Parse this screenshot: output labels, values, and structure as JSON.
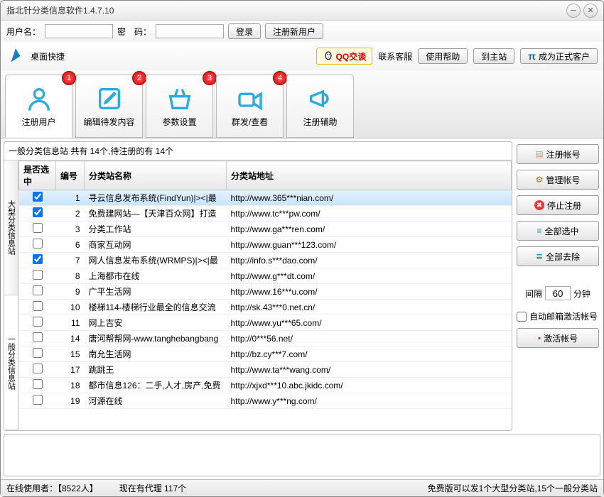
{
  "window": {
    "title": "指北针分类信息软件1.4.7.10"
  },
  "login": {
    "user_label": "用户名：",
    "pass_label": "密　码：",
    "login_btn": "登录",
    "register_btn": "注册新用户"
  },
  "toolbar": {
    "desktop_shortcut": "桌面快捷",
    "qq_chat": "QQ交谈",
    "contact_service": "联系客服",
    "use_help": "使用帮助",
    "to_main": "到主站",
    "become_customer": "成为正式客户"
  },
  "tabs": [
    {
      "label": "注册用户",
      "badge": "1"
    },
    {
      "label": "编辑待发内容",
      "badge": "2"
    },
    {
      "label": "参数设置",
      "badge": "3"
    },
    {
      "label": "群发/查看",
      "badge": "4"
    },
    {
      "label": "注册辅助",
      "badge": ""
    }
  ],
  "summary": "一般分类信息站 共有 14个,待注册的有 14个",
  "vtabs": {
    "big": "大型分类信息站",
    "general": "一般分类信息站"
  },
  "columns": {
    "check": "是否选中",
    "id": "编号",
    "name": "分类站名称",
    "url": "分类站地址"
  },
  "rows": [
    {
      "checked": true,
      "id": "1",
      "name": "寻云信息发布系统(FindYun)|><|最",
      "url": "http://www.365***nian.com/"
    },
    {
      "checked": true,
      "id": "2",
      "name": "免费建网站—【天津百众网】打造",
      "url": "http://www.tc***pw.com/"
    },
    {
      "checked": false,
      "id": "3",
      "name": "分类工作站",
      "url": "http://www.ga***ren.com/"
    },
    {
      "checked": false,
      "id": "6",
      "name": "商家互动网",
      "url": "http://www.guan***123.com/"
    },
    {
      "checked": true,
      "id": "7",
      "name": "网人信息发布系统(WRMPS)|><|最",
      "url": "http://info.s***dao.com/"
    },
    {
      "checked": false,
      "id": "8",
      "name": "上海都市在线",
      "url": "http://www.g***dt.com/"
    },
    {
      "checked": false,
      "id": "9",
      "name": "广平生活网",
      "url": "http://www.16***u.com/"
    },
    {
      "checked": false,
      "id": "10",
      "name": "楼梯114-楼梯行业最全的信息交流",
      "url": "http://sk.43***0.net.cn/"
    },
    {
      "checked": false,
      "id": "11",
      "name": "网上吉安",
      "url": "http://www.yu***65.com/"
    },
    {
      "checked": false,
      "id": "14",
      "name": "唐河帮帮网-www.tanghebangbang",
      "url": "http://0***56.net/"
    },
    {
      "checked": false,
      "id": "15",
      "name": "南允生活网",
      "url": "http://bz.cy***7.com/"
    },
    {
      "checked": false,
      "id": "17",
      "name": "跳跳王",
      "url": "http://www.ta***wang.com/"
    },
    {
      "checked": false,
      "id": "18",
      "name": "都市信息126：二手,人才,房产,免费",
      "url": "http://xjxd***10.abc.jkidc.com/"
    },
    {
      "checked": false,
      "id": "19",
      "name": "河源在线",
      "url": "http://www.y***ng.com/"
    }
  ],
  "side": {
    "register_account": "注册帐号",
    "manage_account": "管理帐号",
    "stop_register": "停止注册",
    "select_all": "全部选中",
    "deselect_all": "全部去除",
    "interval_label": "间隔",
    "interval_value": "60",
    "interval_unit": "分钟",
    "auto_email": "自动邮箱激活帐号",
    "activate": "激活帐号"
  },
  "status": {
    "online": "在线使用者：【8522人】",
    "agents": "现在有代理 117个",
    "free": "免费版可以发1个大型分类站,15个一般分类站"
  }
}
